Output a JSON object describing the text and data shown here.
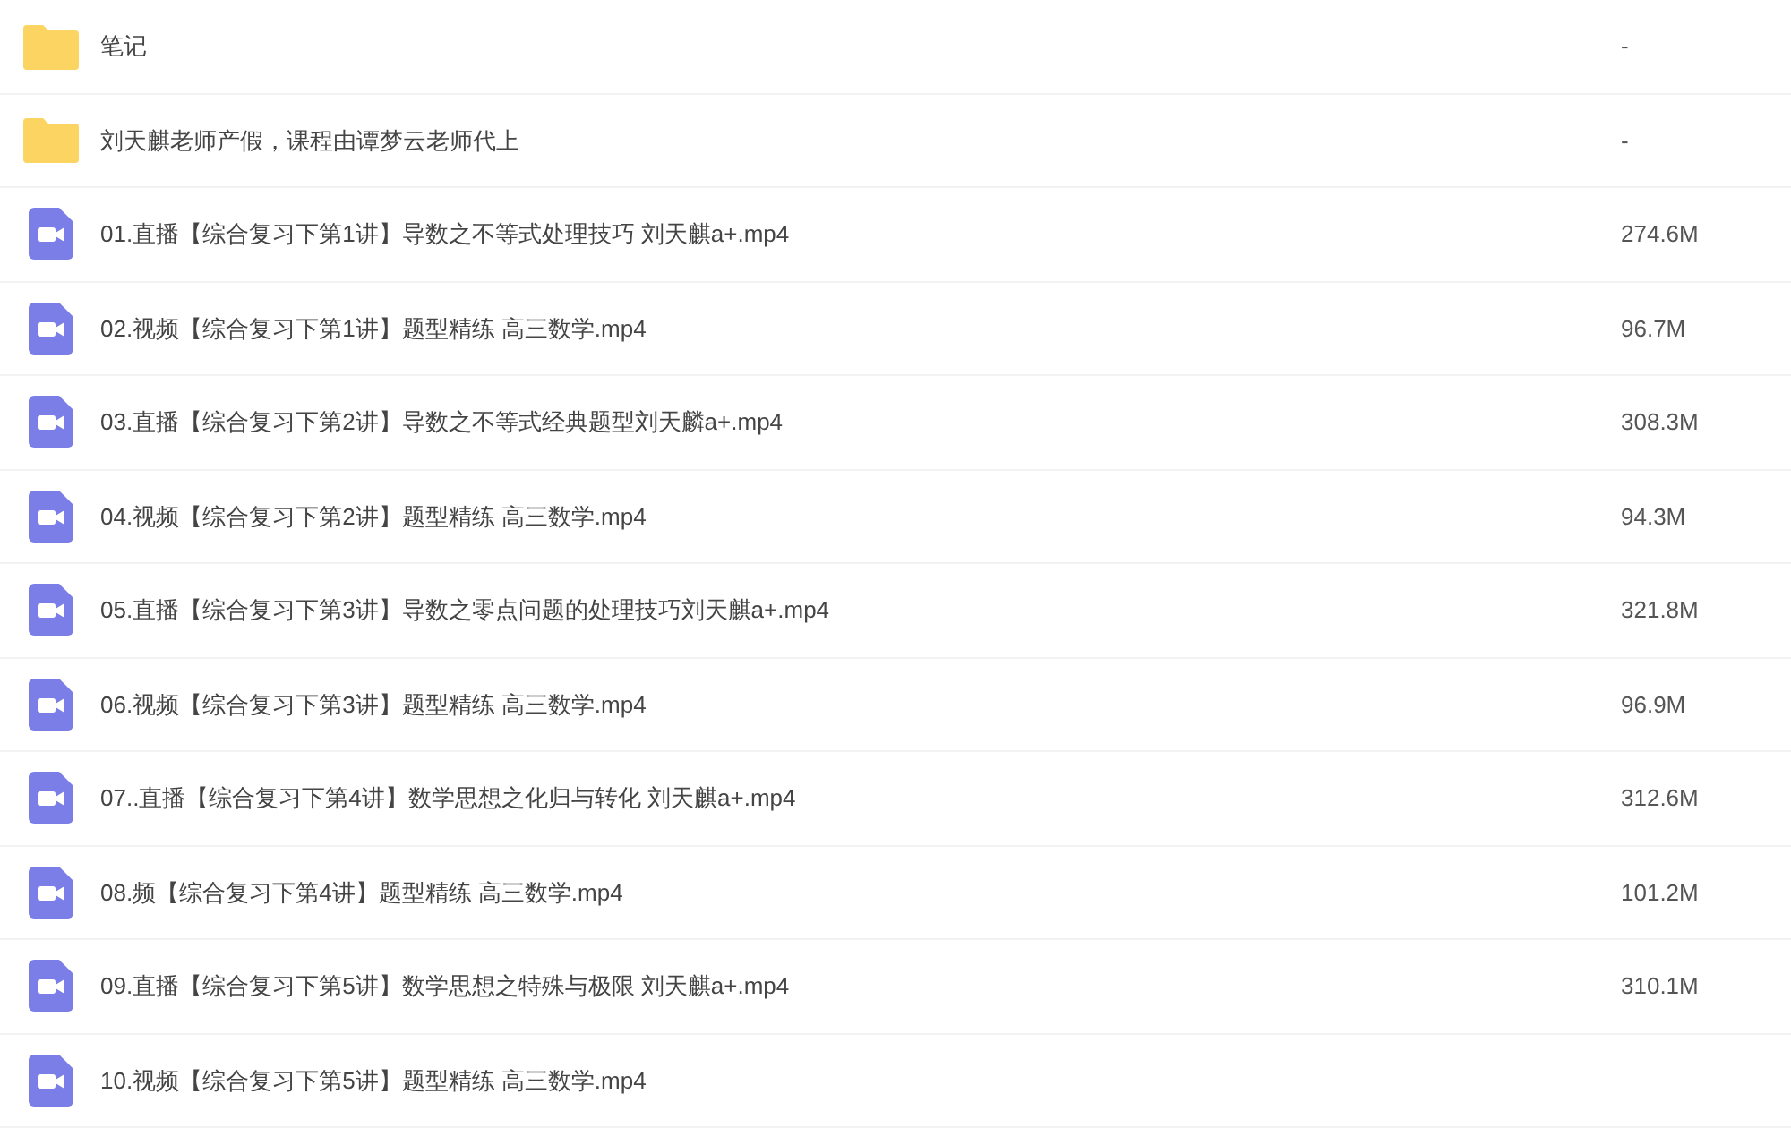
{
  "files": [
    {
      "kind": "folder",
      "name": "笔记",
      "size": "-"
    },
    {
      "kind": "folder",
      "name": "刘天麒老师产假，课程由谭梦云老师代上",
      "size": "-"
    },
    {
      "kind": "video",
      "name": "01.直播【综合复习下第1讲】导数之不等式处理技巧 刘天麒a+.mp4",
      "size": "274.6M"
    },
    {
      "kind": "video",
      "name": "02.视频【综合复习下第1讲】题型精练 高三数学.mp4",
      "size": "96.7M"
    },
    {
      "kind": "video",
      "name": "03.直播【综合复习下第2讲】导数之不等式经典题型刘天麟a+.mp4",
      "size": "308.3M"
    },
    {
      "kind": "video",
      "name": "04.视频【综合复习下第2讲】题型精练 高三数学.mp4",
      "size": "94.3M"
    },
    {
      "kind": "video",
      "name": "05.直播【综合复习下第3讲】导数之零点问题的处理技巧刘天麒a+.mp4",
      "size": "321.8M"
    },
    {
      "kind": "video",
      "name": "06.视频【综合复习下第3讲】题型精练 高三数学.mp4",
      "size": "96.9M"
    },
    {
      "kind": "video",
      "name": "07..直播【综合复习下第4讲】数学思想之化归与转化 刘天麒a+.mp4",
      "size": "312.6M"
    },
    {
      "kind": "video",
      "name": "08.频【综合复习下第4讲】题型精练 高三数学.mp4",
      "size": "101.2M"
    },
    {
      "kind": "video",
      "name": "09.直播【综合复习下第5讲】数学思想之特殊与极限 刘天麒a+.mp4",
      "size": "310.1M"
    },
    {
      "kind": "video",
      "name": "10.视频【综合复习下第5讲】题型精练 高三数学.mp4"
    }
  ]
}
